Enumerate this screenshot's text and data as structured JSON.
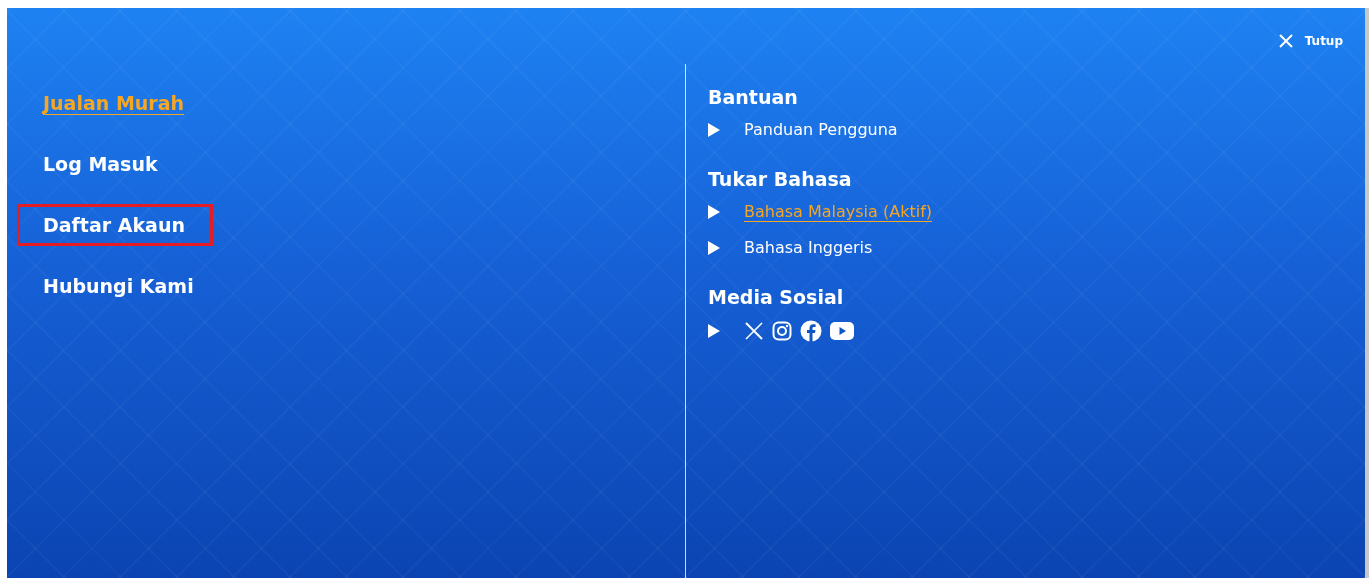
{
  "close": {
    "label": "Tutup"
  },
  "menu": [
    {
      "label": "Jualan Murah",
      "selected": true,
      "highlighted": false
    },
    {
      "label": "Log Masuk",
      "selected": false,
      "highlighted": false
    },
    {
      "label": "Daftar Akaun",
      "selected": false,
      "highlighted": true
    },
    {
      "label": "Hubungi Kami",
      "selected": false,
      "highlighted": false
    }
  ],
  "sections": [
    {
      "title": "Bantuan",
      "links": [
        {
          "label": "Panduan Pengguna",
          "selected": false
        }
      ]
    },
    {
      "title": "Tukar Bahasa",
      "links": [
        {
          "label": "Bahasa Malaysia (Aktif)",
          "selected": true
        },
        {
          "label": "Bahasa Inggeris",
          "selected": false
        }
      ]
    },
    {
      "title": "Media Sosial",
      "social": [
        {
          "kind": "x"
        },
        {
          "kind": "instagram"
        },
        {
          "kind": "facebook"
        },
        {
          "kind": "youtube"
        }
      ]
    }
  ]
}
